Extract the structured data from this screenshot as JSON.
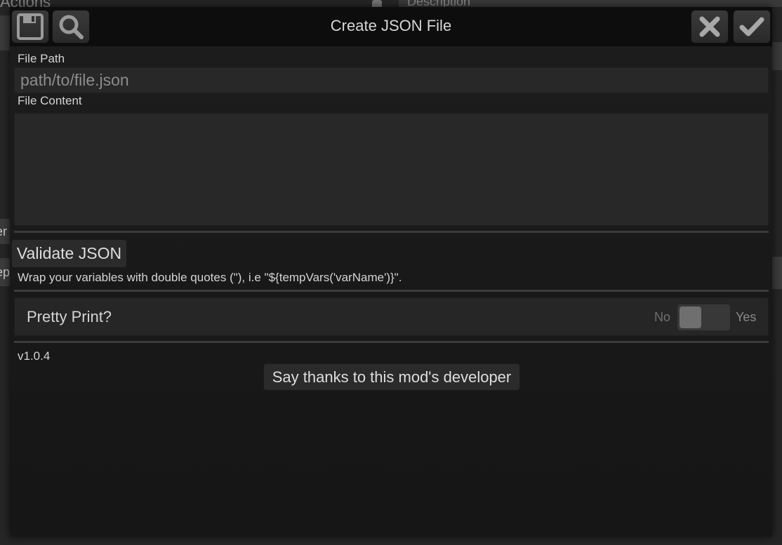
{
  "background": {
    "actions_header": "Actions",
    "description_header": "Description",
    "left_tab_1": "er",
    "left_tab_2": "ep"
  },
  "dialog": {
    "title": "Create JSON File",
    "icons": {
      "save": "floppy-disk-icon",
      "search": "magnifier-icon",
      "cancel": "close-x-icon",
      "confirm": "checkmark-icon"
    },
    "file_path": {
      "label": "File Path",
      "value": "",
      "placeholder": "path/to/file.json"
    },
    "file_content": {
      "label": "File Content",
      "value": ""
    },
    "validate_button": "Validate JSON",
    "hint": "Wrap your variables with double quotes (\"), i.e \"${tempVars('varName')}\".",
    "pretty_print": {
      "label": "Pretty Print?",
      "off_label": "No",
      "on_label": "Yes",
      "enabled": false
    },
    "version": "v1.0.4",
    "thanks_button": "Say thanks to this mod's developer"
  },
  "colors": {
    "dialog_bg": "#1a1a1a",
    "titlebar_bg": "#0d0d0d",
    "input_bg": "#282828",
    "button_bg": "#2b2b2b",
    "text": "#d4d4d4"
  }
}
